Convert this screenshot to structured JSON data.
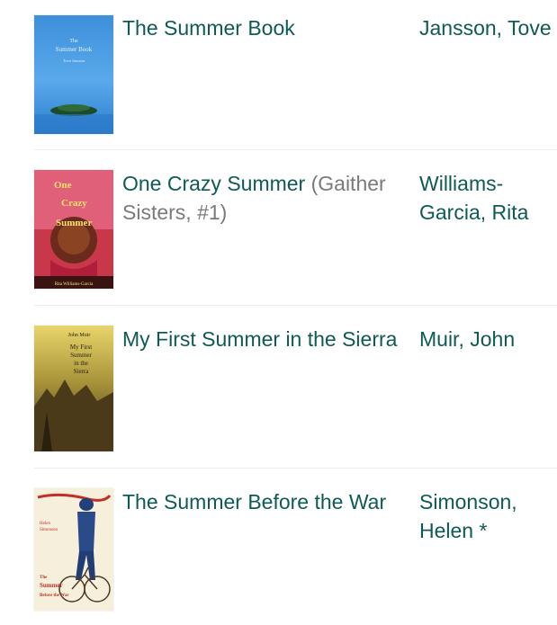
{
  "books": [
    {
      "title": "The Summer Book",
      "series": "",
      "author": "Jansson, Tove",
      "author_suffix": "",
      "cover_lines": [
        "The",
        "Summer Book",
        "Tove Jansson"
      ]
    },
    {
      "title": "One Crazy Summer",
      "series": "(Gaither Sisters, #1)",
      "author": "Williams-Garcia, Rita",
      "author_suffix": "",
      "cover_lines": [
        "One",
        "Crazy",
        "Summer",
        "Rita Williams-Garcia"
      ]
    },
    {
      "title": "My First Summer in the Sierra",
      "series": "",
      "author": "Muir, John",
      "author_suffix": "",
      "cover_lines": [
        "John Muir",
        "My First",
        "Summer",
        "in the",
        "Sierra"
      ]
    },
    {
      "title": "The Summer Before the War",
      "series": "",
      "author": "Simonson, Helen",
      "author_suffix": "*",
      "cover_lines": [
        "Helen",
        "Simonson",
        "The",
        "Summer",
        "Before the War"
      ]
    }
  ],
  "colors": {
    "link": "#0f5a55",
    "series": "#7a7a7a",
    "divider": "#ececec"
  }
}
